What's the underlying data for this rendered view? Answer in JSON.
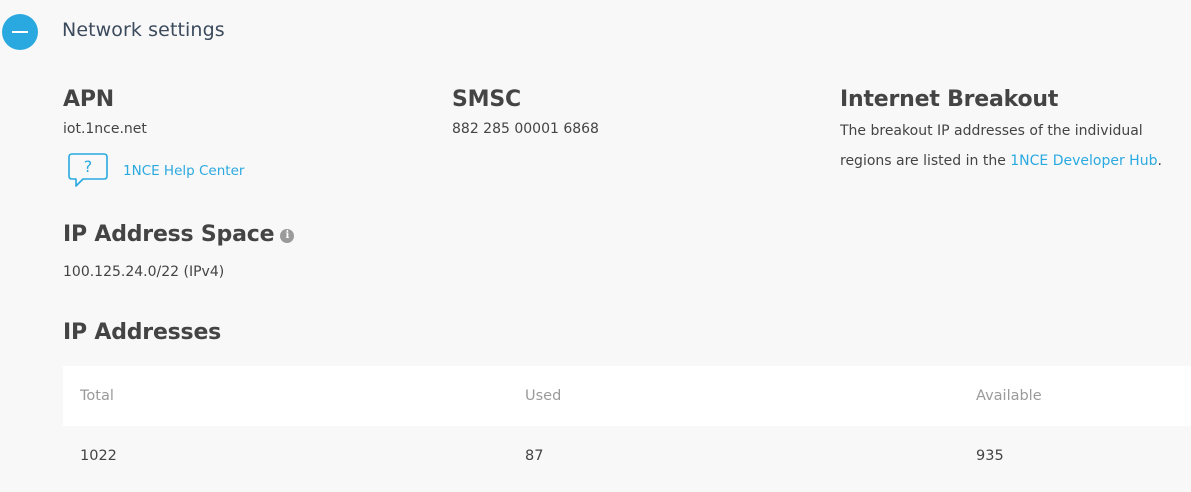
{
  "header": {
    "title": "Network settings"
  },
  "apn": {
    "title": "APN",
    "value": "iot.1nce.net",
    "help_link_label": "1NCE Help Center",
    "help_icon_glyph": "?"
  },
  "smsc": {
    "title": "SMSC",
    "value": "882 285 00001 6868"
  },
  "internet_breakout": {
    "title": "Internet Breakout",
    "text_before": "The breakout IP addresses of the individual regions are listed in the ",
    "link_label": "1NCE Developer Hub",
    "text_after": "."
  },
  "ip_address_space": {
    "title": "IP Address Space",
    "info_glyph": "i",
    "value": "100.125.24.0/22 (IPv4)"
  },
  "ip_addresses": {
    "title": "IP Addresses",
    "columns": [
      "Total",
      "Used",
      "Available"
    ],
    "rows": [
      [
        "1022",
        "87",
        "935"
      ]
    ]
  },
  "colors": {
    "accent": "#2aa9e0",
    "background": "#f8f8f8",
    "text": "#444444",
    "muted": "#9a9a9a"
  }
}
